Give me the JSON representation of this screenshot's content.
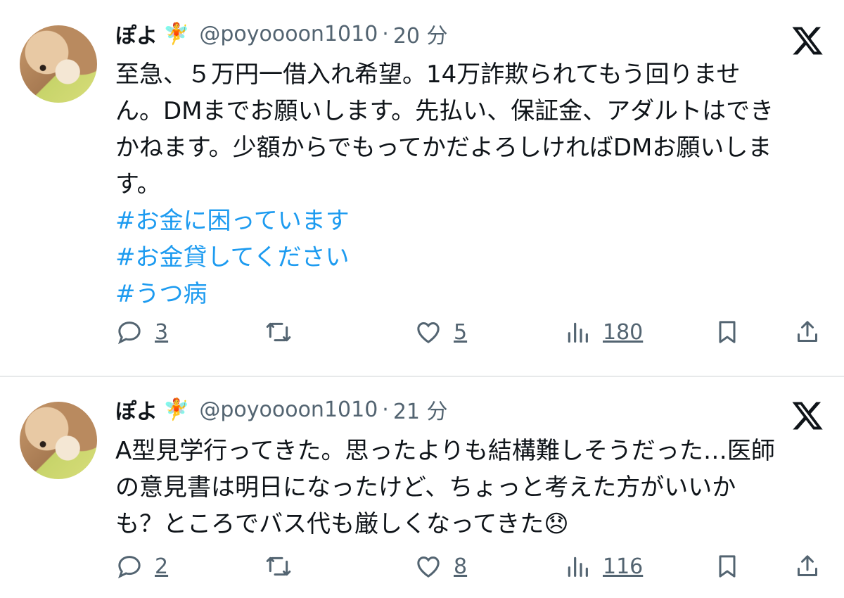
{
  "tweets": [
    {
      "author_name": "ぽよ",
      "author_emoji": "🧚",
      "handle": "@poyoooon1010",
      "separator": "·",
      "time": "20 分",
      "lines": [
        "至急、５万円一借入れ希望。14万詐欺られてもう回りませ",
        "ん。DMまでお願いします。先払い、保証金、アダルトはでき",
        "かねます。少額からでもってかだよろしければDMお願いしま",
        "す。"
      ],
      "hashtags": [
        "#お金に困っています",
        "#お金貸してください",
        "#うつ病"
      ],
      "replies": "3",
      "likes": "5",
      "views": "180"
    },
    {
      "author_name": "ぽよ",
      "author_emoji": "🧚",
      "handle": "@poyoooon1010",
      "separator": "·",
      "time": "21 分",
      "lines": [
        "A型見学行ってきた。思ったよりも結構難しそうだった…医師",
        "の意見書は明日になったけど、ちょっと考えた方がいいか",
        "も？ところでバス代も厳しくなってきた😞"
      ],
      "hashtags": [],
      "replies": "2",
      "likes": "8",
      "views": "116"
    }
  ],
  "icons": {
    "brand": "x-logo-icon",
    "reply": "reply-icon",
    "repost": "repost-icon",
    "like": "like-icon",
    "views": "views-icon",
    "bookmark": "bookmark-icon",
    "share": "share-icon"
  },
  "colors": {
    "text": "#0f1419",
    "secondary": "#536471",
    "hashtag": "#1d9bf0",
    "divider": "#e7e9ea"
  }
}
